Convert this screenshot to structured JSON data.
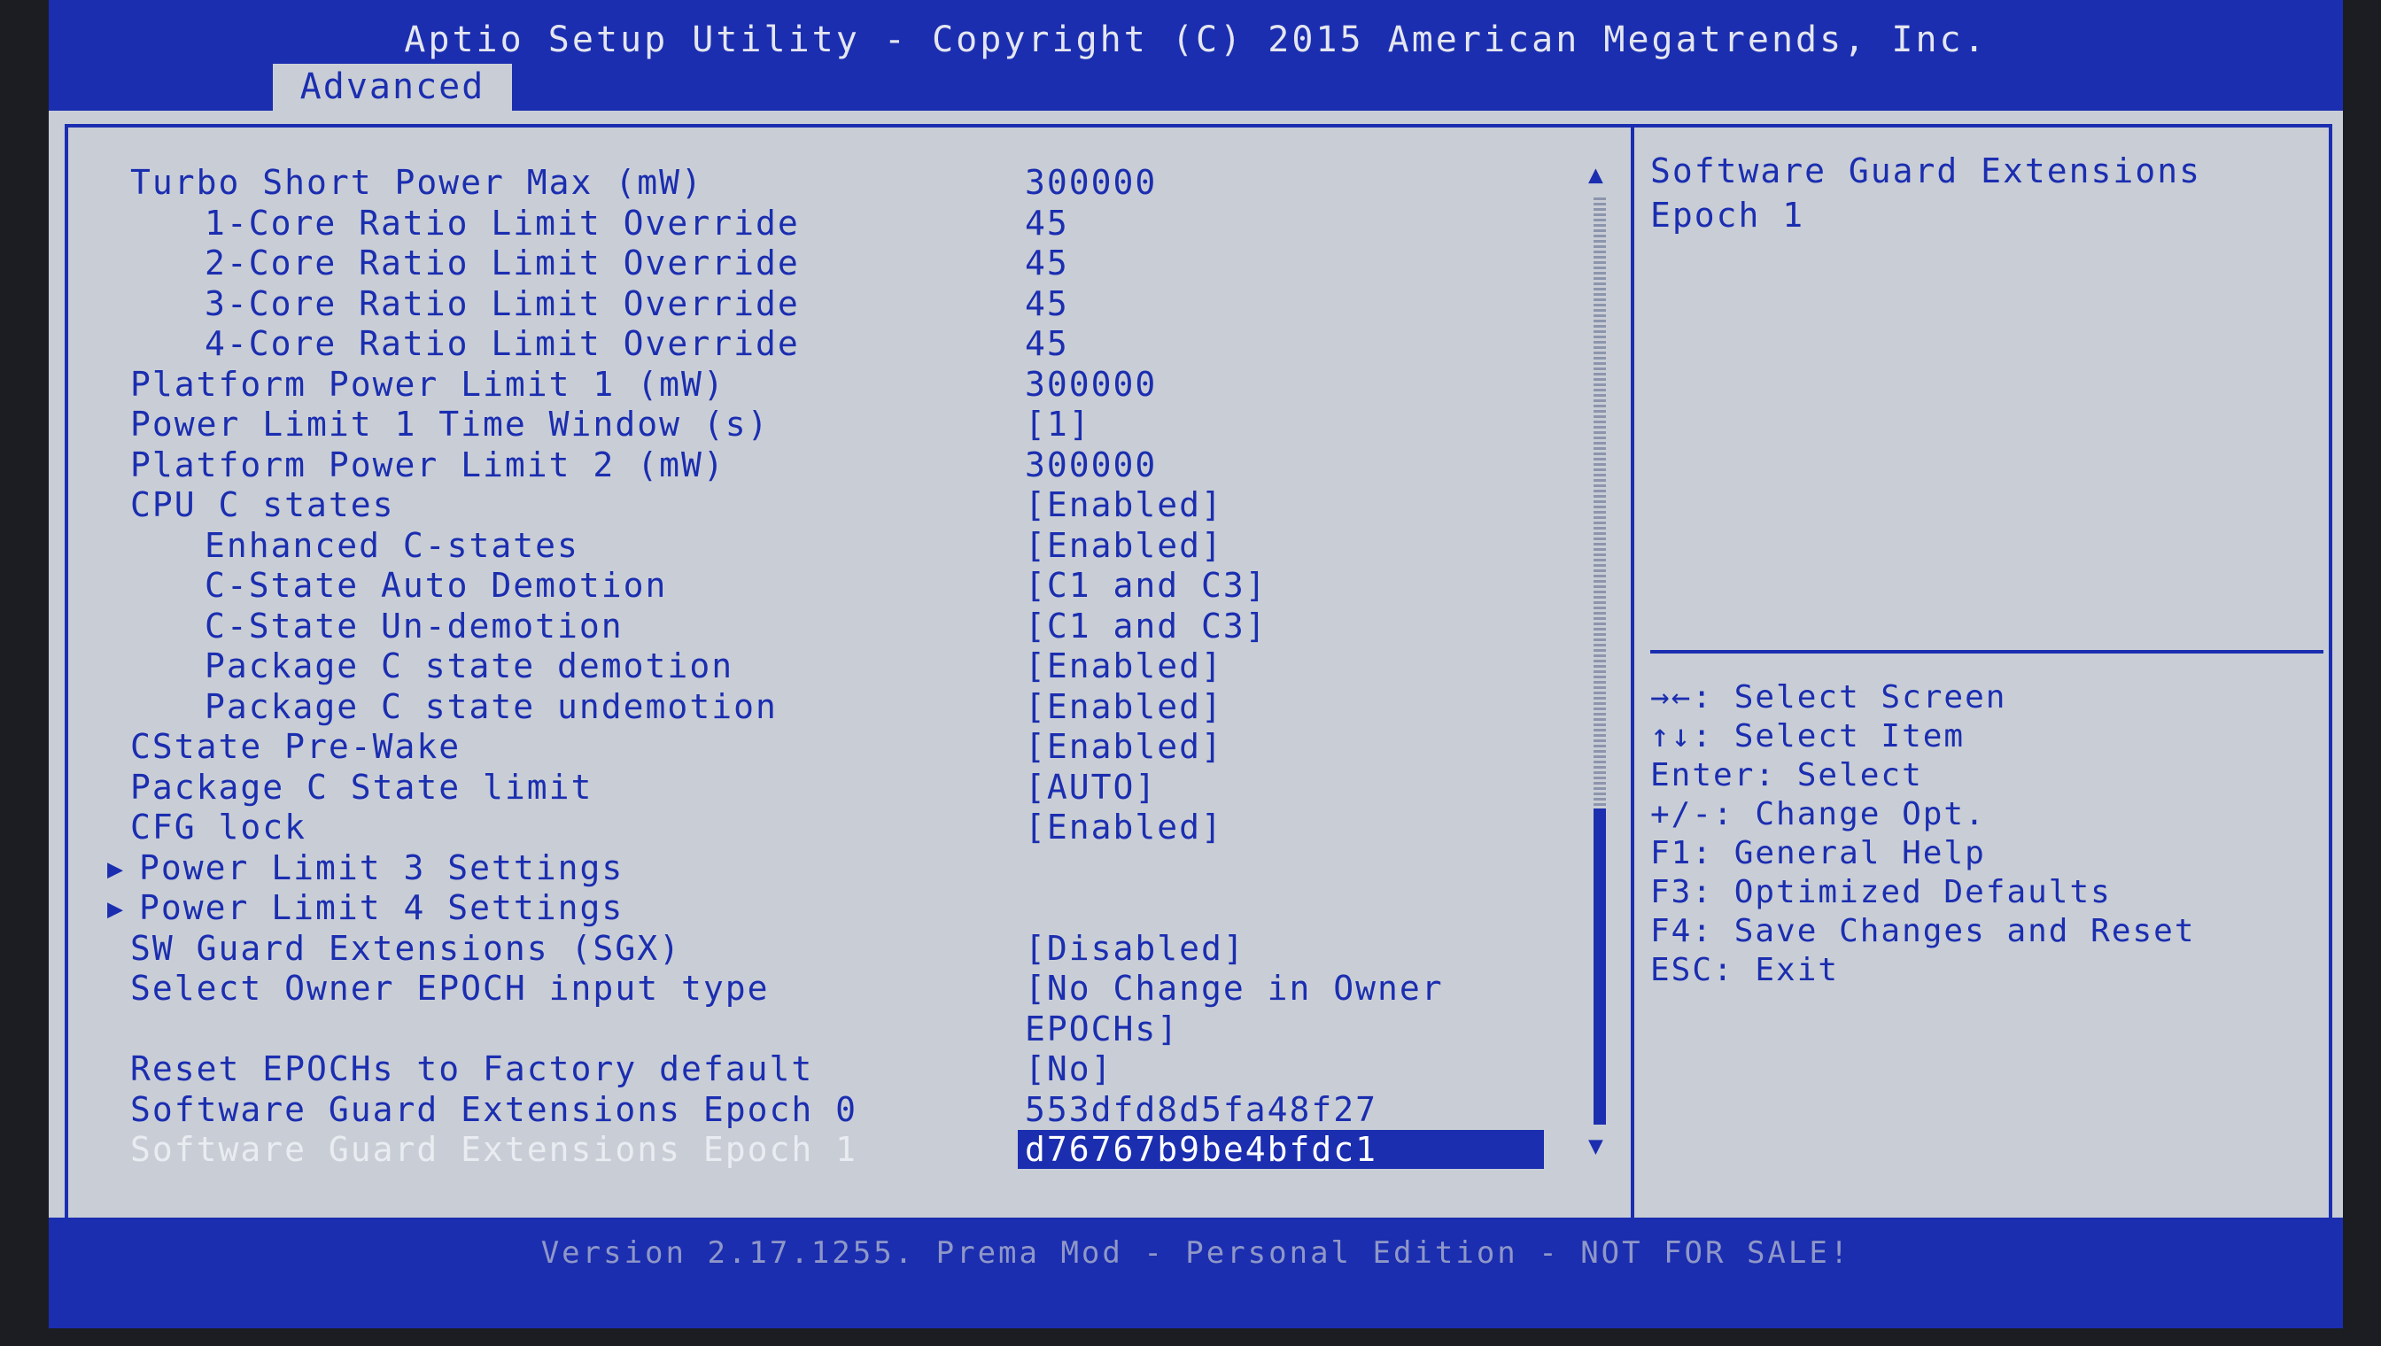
{
  "header": {
    "title": "Aptio Setup Utility - Copyright (C) 2015 American Megatrends, Inc.",
    "tabs": [
      {
        "label": "Advanced",
        "active": true
      }
    ]
  },
  "settings": [
    {
      "label": "Turbo Short Power Max (mW)",
      "value": "300000",
      "indent": 0,
      "submenu": false
    },
    {
      "label": "1-Core Ratio Limit Override",
      "value": "45",
      "indent": 1,
      "submenu": false
    },
    {
      "label": "2-Core Ratio Limit Override",
      "value": "45",
      "indent": 1,
      "submenu": false
    },
    {
      "label": "3-Core Ratio Limit Override",
      "value": "45",
      "indent": 1,
      "submenu": false
    },
    {
      "label": "4-Core Ratio Limit Override",
      "value": "45",
      "indent": 1,
      "submenu": false
    },
    {
      "label": "Platform Power Limit 1 (mW)",
      "value": "300000",
      "indent": 0,
      "submenu": false
    },
    {
      "label": "Power Limit 1 Time Window (s)",
      "value": "[1]",
      "indent": 0,
      "submenu": false
    },
    {
      "label": "Platform Power Limit 2 (mW)",
      "value": "300000",
      "indent": 0,
      "submenu": false
    },
    {
      "label": "CPU C states",
      "value": "[Enabled]",
      "indent": 0,
      "submenu": false
    },
    {
      "label": "Enhanced C-states",
      "value": "[Enabled]",
      "indent": 1,
      "submenu": false
    },
    {
      "label": "C-State Auto Demotion",
      "value": "[C1 and C3]",
      "indent": 1,
      "submenu": false
    },
    {
      "label": "C-State Un-demotion",
      "value": "[C1 and C3]",
      "indent": 1,
      "submenu": false
    },
    {
      "label": "Package C state demotion",
      "value": "[Enabled]",
      "indent": 1,
      "submenu": false
    },
    {
      "label": "Package C state undemotion",
      "value": "[Enabled]",
      "indent": 1,
      "submenu": false
    },
    {
      "label": "CState Pre-Wake",
      "value": "[Enabled]",
      "indent": 0,
      "submenu": false
    },
    {
      "label": "Package C State limit",
      "value": "[AUTO]",
      "indent": 0,
      "submenu": false
    },
    {
      "label": "CFG lock",
      "value": "[Enabled]",
      "indent": 0,
      "submenu": false
    },
    {
      "label": "Power Limit 3 Settings",
      "value": "",
      "indent": 0,
      "submenu": true
    },
    {
      "label": "Power Limit 4 Settings",
      "value": "",
      "indent": 0,
      "submenu": true
    },
    {
      "label": "SW Guard Extensions (SGX)",
      "value": "[Disabled]",
      "indent": 0,
      "submenu": false
    },
    {
      "label": "Select Owner EPOCH input type",
      "value": "[No Change in Owner",
      "indent": 0,
      "submenu": false
    },
    {
      "label": "",
      "value": "EPOCHs]",
      "indent": 0,
      "submenu": false
    },
    {
      "label": "Reset EPOCHs to Factory default",
      "value": "[No]",
      "indent": 0,
      "submenu": false
    },
    {
      "label": "Software Guard Extensions Epoch 0",
      "value": "553dfd8d5fa48f27",
      "indent": 0,
      "submenu": false
    },
    {
      "label": "Software Guard Extensions Epoch 1",
      "value": "d76767b9be4bfdc1",
      "indent": 0,
      "submenu": false,
      "selected": true
    }
  ],
  "scrollbar": {
    "up_icon": "▲",
    "down_icon": "▼",
    "thumb_start": 0.66,
    "thumb_end": 1.0
  },
  "help": {
    "description": "Software Guard Extensions\nEpoch 1",
    "keys": [
      "→←: Select Screen",
      "↑↓: Select Item",
      "Enter: Select",
      "+/-: Change Opt.",
      "F1: General Help",
      "F3: Optimized Defaults",
      "F4: Save Changes and Reset",
      "ESC: Exit"
    ]
  },
  "footer": {
    "text": "Version 2.17.1255. Prema Mod - Personal Edition - NOT FOR SALE!"
  },
  "colors": {
    "accent": "#1b2eb0",
    "background": "#c9ced6",
    "highlight_text": "#ffffff"
  },
  "icons": {
    "submenu": "submenu-triangle-icon",
    "scroll_up": "scroll-up-arrow-icon",
    "scroll_down": "scroll-down-arrow-icon"
  }
}
